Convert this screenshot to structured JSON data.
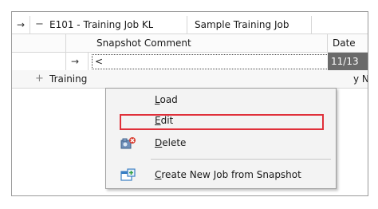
{
  "rows": {
    "job": {
      "arrow": "→",
      "expander": "−",
      "job_name": "E101 - Training Job KL",
      "description": "Sample Training Job"
    },
    "snapshot_header": {
      "comment_header": "Snapshot Comment",
      "date_header": "Date"
    },
    "snapshot": {
      "arrow": "→",
      "comment_value": "<",
      "date_value": "11/13"
    },
    "training": {
      "expander": "+",
      "label": "Training",
      "right_text": "y No"
    }
  },
  "context_menu": {
    "items": [
      {
        "label": "Load",
        "underline": "L",
        "icon": "none"
      },
      {
        "label": "Edit",
        "underline": "E",
        "icon": "none",
        "highlighted": true
      },
      {
        "label": "Delete",
        "underline": "D",
        "icon": "delete-snapshot-icon"
      },
      {
        "label": "Create New Job from Snapshot",
        "underline": "C",
        "icon": "create-job-icon"
      }
    ]
  },
  "colors": {
    "highlight_border": "#e0303a",
    "date_cell_bg": "#6a6a6a",
    "delete_badge": "#d83b2e",
    "icon_blue": "#3a7fc4"
  }
}
